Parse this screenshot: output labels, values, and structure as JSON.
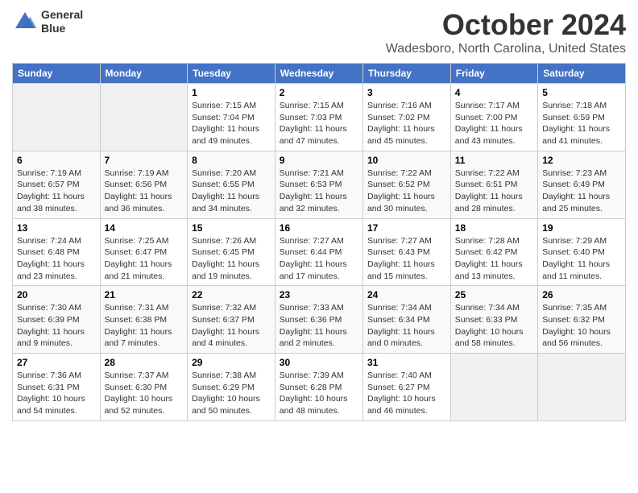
{
  "logo": {
    "line1": "General",
    "line2": "Blue"
  },
  "title": "October 2024",
  "location": "Wadesboro, North Carolina, United States",
  "weekdays": [
    "Sunday",
    "Monday",
    "Tuesday",
    "Wednesday",
    "Thursday",
    "Friday",
    "Saturday"
  ],
  "weeks": [
    [
      {
        "num": "",
        "detail": ""
      },
      {
        "num": "",
        "detail": ""
      },
      {
        "num": "1",
        "detail": "Sunrise: 7:15 AM\nSunset: 7:04 PM\nDaylight: 11 hours and 49 minutes."
      },
      {
        "num": "2",
        "detail": "Sunrise: 7:15 AM\nSunset: 7:03 PM\nDaylight: 11 hours and 47 minutes."
      },
      {
        "num": "3",
        "detail": "Sunrise: 7:16 AM\nSunset: 7:02 PM\nDaylight: 11 hours and 45 minutes."
      },
      {
        "num": "4",
        "detail": "Sunrise: 7:17 AM\nSunset: 7:00 PM\nDaylight: 11 hours and 43 minutes."
      },
      {
        "num": "5",
        "detail": "Sunrise: 7:18 AM\nSunset: 6:59 PM\nDaylight: 11 hours and 41 minutes."
      }
    ],
    [
      {
        "num": "6",
        "detail": "Sunrise: 7:19 AM\nSunset: 6:57 PM\nDaylight: 11 hours and 38 minutes."
      },
      {
        "num": "7",
        "detail": "Sunrise: 7:19 AM\nSunset: 6:56 PM\nDaylight: 11 hours and 36 minutes."
      },
      {
        "num": "8",
        "detail": "Sunrise: 7:20 AM\nSunset: 6:55 PM\nDaylight: 11 hours and 34 minutes."
      },
      {
        "num": "9",
        "detail": "Sunrise: 7:21 AM\nSunset: 6:53 PM\nDaylight: 11 hours and 32 minutes."
      },
      {
        "num": "10",
        "detail": "Sunrise: 7:22 AM\nSunset: 6:52 PM\nDaylight: 11 hours and 30 minutes."
      },
      {
        "num": "11",
        "detail": "Sunrise: 7:22 AM\nSunset: 6:51 PM\nDaylight: 11 hours and 28 minutes."
      },
      {
        "num": "12",
        "detail": "Sunrise: 7:23 AM\nSunset: 6:49 PM\nDaylight: 11 hours and 25 minutes."
      }
    ],
    [
      {
        "num": "13",
        "detail": "Sunrise: 7:24 AM\nSunset: 6:48 PM\nDaylight: 11 hours and 23 minutes."
      },
      {
        "num": "14",
        "detail": "Sunrise: 7:25 AM\nSunset: 6:47 PM\nDaylight: 11 hours and 21 minutes."
      },
      {
        "num": "15",
        "detail": "Sunrise: 7:26 AM\nSunset: 6:45 PM\nDaylight: 11 hours and 19 minutes."
      },
      {
        "num": "16",
        "detail": "Sunrise: 7:27 AM\nSunset: 6:44 PM\nDaylight: 11 hours and 17 minutes."
      },
      {
        "num": "17",
        "detail": "Sunrise: 7:27 AM\nSunset: 6:43 PM\nDaylight: 11 hours and 15 minutes."
      },
      {
        "num": "18",
        "detail": "Sunrise: 7:28 AM\nSunset: 6:42 PM\nDaylight: 11 hours and 13 minutes."
      },
      {
        "num": "19",
        "detail": "Sunrise: 7:29 AM\nSunset: 6:40 PM\nDaylight: 11 hours and 11 minutes."
      }
    ],
    [
      {
        "num": "20",
        "detail": "Sunrise: 7:30 AM\nSunset: 6:39 PM\nDaylight: 11 hours and 9 minutes."
      },
      {
        "num": "21",
        "detail": "Sunrise: 7:31 AM\nSunset: 6:38 PM\nDaylight: 11 hours and 7 minutes."
      },
      {
        "num": "22",
        "detail": "Sunrise: 7:32 AM\nSunset: 6:37 PM\nDaylight: 11 hours and 4 minutes."
      },
      {
        "num": "23",
        "detail": "Sunrise: 7:33 AM\nSunset: 6:36 PM\nDaylight: 11 hours and 2 minutes."
      },
      {
        "num": "24",
        "detail": "Sunrise: 7:34 AM\nSunset: 6:34 PM\nDaylight: 11 hours and 0 minutes."
      },
      {
        "num": "25",
        "detail": "Sunrise: 7:34 AM\nSunset: 6:33 PM\nDaylight: 10 hours and 58 minutes."
      },
      {
        "num": "26",
        "detail": "Sunrise: 7:35 AM\nSunset: 6:32 PM\nDaylight: 10 hours and 56 minutes."
      }
    ],
    [
      {
        "num": "27",
        "detail": "Sunrise: 7:36 AM\nSunset: 6:31 PM\nDaylight: 10 hours and 54 minutes."
      },
      {
        "num": "28",
        "detail": "Sunrise: 7:37 AM\nSunset: 6:30 PM\nDaylight: 10 hours and 52 minutes."
      },
      {
        "num": "29",
        "detail": "Sunrise: 7:38 AM\nSunset: 6:29 PM\nDaylight: 10 hours and 50 minutes."
      },
      {
        "num": "30",
        "detail": "Sunrise: 7:39 AM\nSunset: 6:28 PM\nDaylight: 10 hours and 48 minutes."
      },
      {
        "num": "31",
        "detail": "Sunrise: 7:40 AM\nSunset: 6:27 PM\nDaylight: 10 hours and 46 minutes."
      },
      {
        "num": "",
        "detail": ""
      },
      {
        "num": "",
        "detail": ""
      }
    ]
  ]
}
